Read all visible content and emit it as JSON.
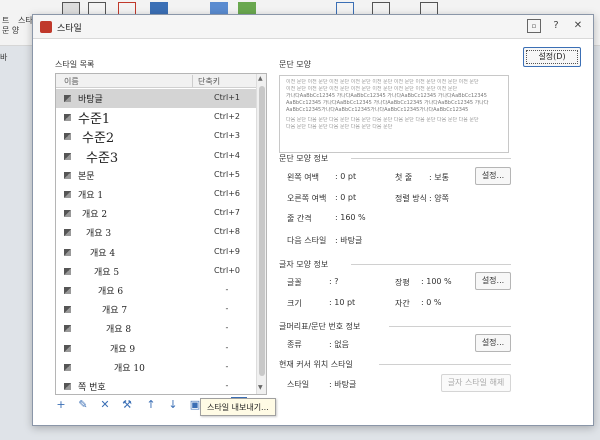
{
  "background": {
    "ribbon_left_labels": [
      "트",
      "문 양",
      "스타"
    ],
    "doc_side_label": "바"
  },
  "dialog": {
    "title": "스타일",
    "help_label": "?",
    "close_label": "✕",
    "context_help_icon": "context-help-icon"
  },
  "style_list": {
    "label": "스타일 목록",
    "header_name": "이름",
    "header_shortcut": "단축키",
    "items": [
      {
        "name": "바탕글",
        "shortcut": "Ctrl+1",
        "selected": true
      },
      {
        "name": "수준1",
        "shortcut": "Ctrl+2"
      },
      {
        "name": "수준2",
        "shortcut": "Ctrl+3"
      },
      {
        "name": "수준3",
        "shortcut": "Ctrl+4"
      },
      {
        "name": "본문",
        "shortcut": "Ctrl+5"
      },
      {
        "name": "개요 1",
        "shortcut": "Ctrl+6"
      },
      {
        "name": "개요 2",
        "shortcut": "Ctrl+7"
      },
      {
        "name": "개요 3",
        "shortcut": "Ctrl+8"
      },
      {
        "name": "개요 4",
        "shortcut": "Ctrl+9"
      },
      {
        "name": "개요 5",
        "shortcut": "Ctrl+0"
      },
      {
        "name": "개요 6",
        "shortcut": "-"
      },
      {
        "name": "개요 7",
        "shortcut": "-"
      },
      {
        "name": "개요 8",
        "shortcut": "-"
      },
      {
        "name": "개요 9",
        "shortcut": "-"
      },
      {
        "name": "개요 10",
        "shortcut": "-"
      },
      {
        "name": "쪽 번호",
        "shortcut": "-"
      }
    ]
  },
  "toolbar": {
    "tools": [
      {
        "name": "add-style-icon",
        "glyph": "+"
      },
      {
        "name": "edit-style-icon",
        "glyph": "✎"
      },
      {
        "name": "delete-style-icon",
        "glyph": "✕"
      },
      {
        "name": "replace-style-icon",
        "glyph": "⚒"
      },
      {
        "name": "move-up-icon",
        "glyph": "↑"
      },
      {
        "name": "move-down-icon",
        "glyph": "↓"
      },
      {
        "name": "import-style-icon",
        "glyph": "▣"
      },
      {
        "name": "open-folder-icon",
        "glyph": "▭"
      },
      {
        "name": "export-style-icon",
        "glyph": "▤"
      }
    ],
    "tooltip": "스타일 내보내기..."
  },
  "preview": {
    "title": "문단 모양",
    "lines_light": [
      "이전 문단 이전 문단 이전 문단 이전 문단 이전 문단 이전 문단 이전 문단 이전 문단 이전 문단",
      "이전 문단 이전 문단 이전 문단 이전 문단 이전 문단 이전 문단 이전 문단 이전 문단"
    ],
    "lines_dark": [
      "가나다AaBbCc12345   가나다AaBbCc12345   가나다AaBbCc12345   가나다AaBbCc12345",
      "AaBbCc12345 가나다AaBbCc12345 가나다AaBbCc12345 가나다AaBbCc12345 가나다",
      "AaBbCc12345가나다AaBbCc12345가나다AaBbCc12345가나다AaBbCc12345"
    ],
    "lines_after": [
      "다음 문단 다음 문단 다음 문단 다음 문단 다음 문단 다음 문단 다음 문단 다음 문단 다음 문단",
      "다음 문단 다음 문단 다음 문단 다음 문단 다음 문단"
    ]
  },
  "paragraph_info": {
    "title": "문단 모양 정보",
    "left_margin_label": "왼쪽 여백",
    "left_margin_value": ": 0 pt",
    "right_margin_label": "오른쪽 여백",
    "right_margin_value": ": 0 pt",
    "line_spacing_label": "줄 간격",
    "line_spacing_value": ": 160 %",
    "next_style_label": "다음 스타일",
    "next_style_value": ": 바탕글",
    "indent_label": "첫 줄",
    "indent_value": ": 보통",
    "align_label": "정렬 방식",
    "align_value": ": 양쪽",
    "settings_button": "설정..."
  },
  "char_info": {
    "title": "글자 모양 정보",
    "font_label": "글꼴",
    "font_value": ": ?",
    "size_label": "크기",
    "size_value": ": 10 pt",
    "ratio_label": "장평",
    "ratio_value": ": 100 %",
    "spacing_label": "자간",
    "spacing_value": ": 0 %",
    "settings_button": "설정..."
  },
  "numbering_info": {
    "title": "글머리표/문단 번호 정보",
    "kind_label": "종류",
    "kind_value": ": 없음",
    "settings_button": "설정..."
  },
  "cursor_style": {
    "title": "현재 커서 위치 스타일",
    "style_label": "스타일",
    "style_value": ": 바탕글",
    "release_button": "글자 스타일 해제"
  },
  "actions": {
    "apply_button": "설정(D)"
  },
  "colors": {
    "accent": "#3b6fb5",
    "selected_row": "#d4d4d4"
  }
}
